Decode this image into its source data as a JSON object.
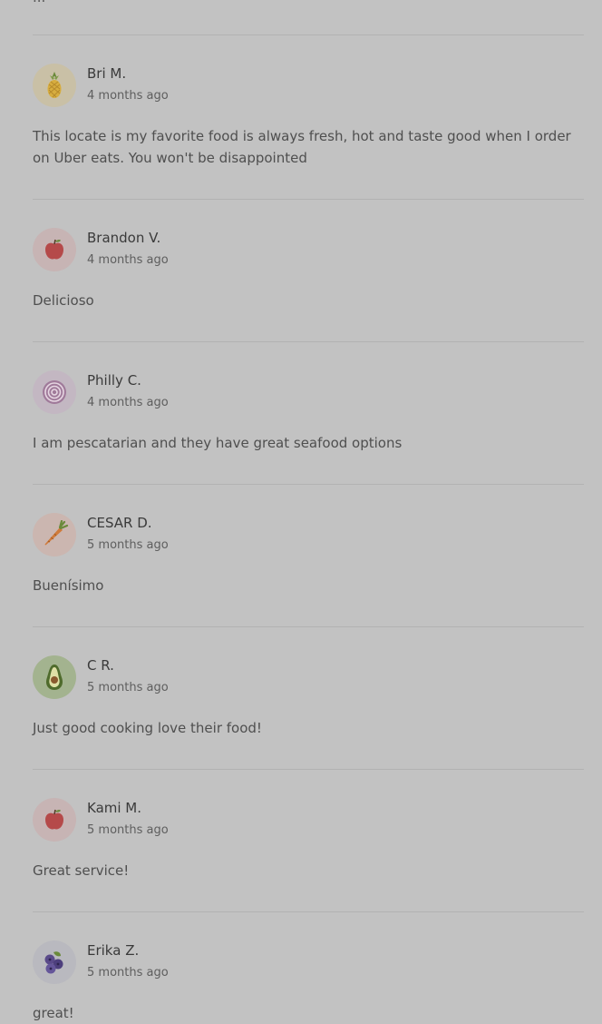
{
  "top_fragment": "...",
  "reviews": [
    {
      "name": "Bri M.",
      "date": "4 months ago",
      "text": "This locate is my favorite food is always fresh, hot and taste good when I order on Uber eats. You won't be disappointed",
      "avatar_icon": "pineapple-icon",
      "avatar_bg": "#c9c0a6"
    },
    {
      "name": "Brandon V.",
      "date": "4 months ago",
      "text": "Delicioso",
      "avatar_icon": "apple-icon",
      "avatar_bg": "#c7b4b4"
    },
    {
      "name": "Philly C.",
      "date": "4 months ago",
      "text": "I am pescatarian and they have great seafood options",
      "avatar_icon": "onion-icon",
      "avatar_bg": "#c3b7c2"
    },
    {
      "name": "CESAR D.",
      "date": "5 months ago",
      "text": "Buenísimo",
      "avatar_icon": "carrot-icon",
      "avatar_bg": "#cbb6b0"
    },
    {
      "name": "C R.",
      "date": "5 months ago",
      "text": "Just good cooking love their food!",
      "avatar_icon": "avocado-icon",
      "avatar_bg": "#a3b38f"
    },
    {
      "name": "Kami M.",
      "date": "5 months ago",
      "text": "Great service!",
      "avatar_icon": "apple-icon",
      "avatar_bg": "#c7b4b4"
    },
    {
      "name": "Erika Z.",
      "date": "5 months ago",
      "text": "great!",
      "avatar_icon": "blueberries-icon",
      "avatar_bg": "#b9b9bf"
    }
  ]
}
